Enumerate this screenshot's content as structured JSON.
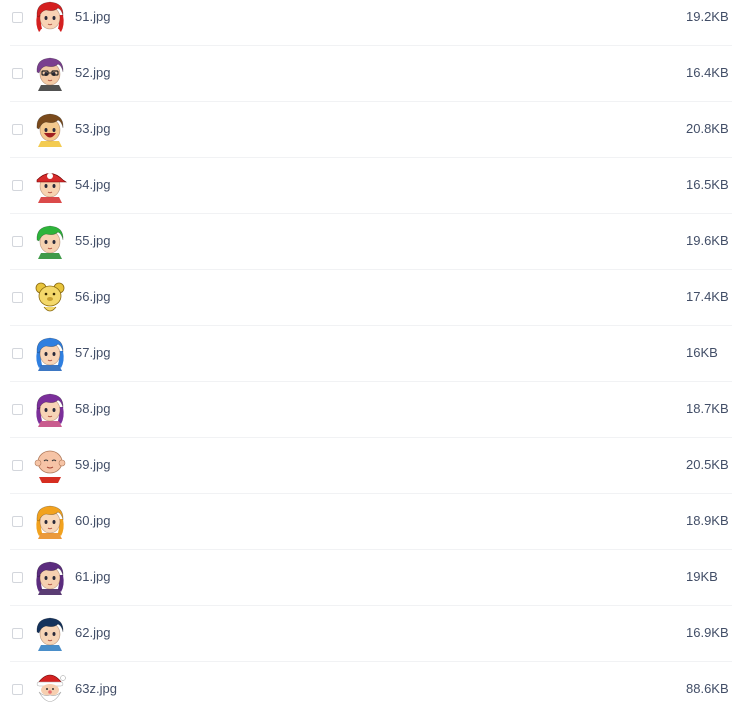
{
  "files": [
    {
      "name": "51.jpg",
      "size": "19.2KB",
      "icon": "red-haired-girl-avatar-icon",
      "hair": "#d42020",
      "skin": "#f8d2b4",
      "accent": "#ffffff"
    },
    {
      "name": "52.jpg",
      "size": "16.4KB",
      "icon": "purple-haired-boy-with-glasses-avatar-icon",
      "hair": "#7a3f8f",
      "skin": "#f2c9a5",
      "accent": "#333333"
    },
    {
      "name": "53.jpg",
      "size": "20.8KB",
      "icon": "laughing-brown-haired-boy-avatar-icon",
      "hair": "#7a4a1c",
      "skin": "#f4c98e",
      "accent": "#f1c232"
    },
    {
      "name": "54.jpg",
      "size": "16.5KB",
      "icon": "boy-with-red-cap-avatar-icon",
      "hair": "#d52a2a",
      "skin": "#f8d3b0",
      "accent": "#d52a2a"
    },
    {
      "name": "55.jpg",
      "size": "19.6KB",
      "icon": "green-haired-boy-avatar-icon",
      "hair": "#2db43a",
      "skin": "#f6d2b0",
      "accent": "#1e8a2a"
    },
    {
      "name": "56.jpg",
      "size": "17.4KB",
      "icon": "yellow-teddy-bear-avatar-icon",
      "hair": "#e8c43b",
      "skin": "#f4d86a",
      "accent": "#8a6a10"
    },
    {
      "name": "57.jpg",
      "size": "16KB",
      "icon": "blue-haired-girl-avatar-icon",
      "hair": "#2f7fe0",
      "skin": "#f8d4b6",
      "accent": "#1b5fb8"
    },
    {
      "name": "58.jpg",
      "size": "18.7KB",
      "icon": "purple-haired-girl-avatar-icon",
      "hair": "#7b2f9a",
      "skin": "#f8d4b6",
      "accent": "#c0407a"
    },
    {
      "name": "59.jpg",
      "size": "20.5KB",
      "icon": "bald-baby-avatar-icon",
      "hair": "#f2b79a",
      "skin": "#f6c4a6",
      "accent": "#d62d20"
    },
    {
      "name": "60.jpg",
      "size": "18.9KB",
      "icon": "orange-haired-girl-avatar-icon",
      "hair": "#f2a21e",
      "skin": "#f8d7b8",
      "accent": "#e8881a"
    },
    {
      "name": "61.jpg",
      "size": "19KB",
      "icon": "purple-haired-woman-avatar-icon",
      "hair": "#5b2c7e",
      "skin": "#f6d0b0",
      "accent": "#3d1a5a"
    },
    {
      "name": "62.jpg",
      "size": "16.9KB",
      "icon": "dark-blue-haired-boy-avatar-icon",
      "hair": "#14325c",
      "skin": "#f6d4b6",
      "accent": "#2a7ac0"
    },
    {
      "name": "63z.jpg",
      "size": "88.6KB",
      "icon": "santa-claus-avatar-icon",
      "hair": "#d42222",
      "skin": "#f6cfb0",
      "accent": "#ffffff"
    }
  ]
}
